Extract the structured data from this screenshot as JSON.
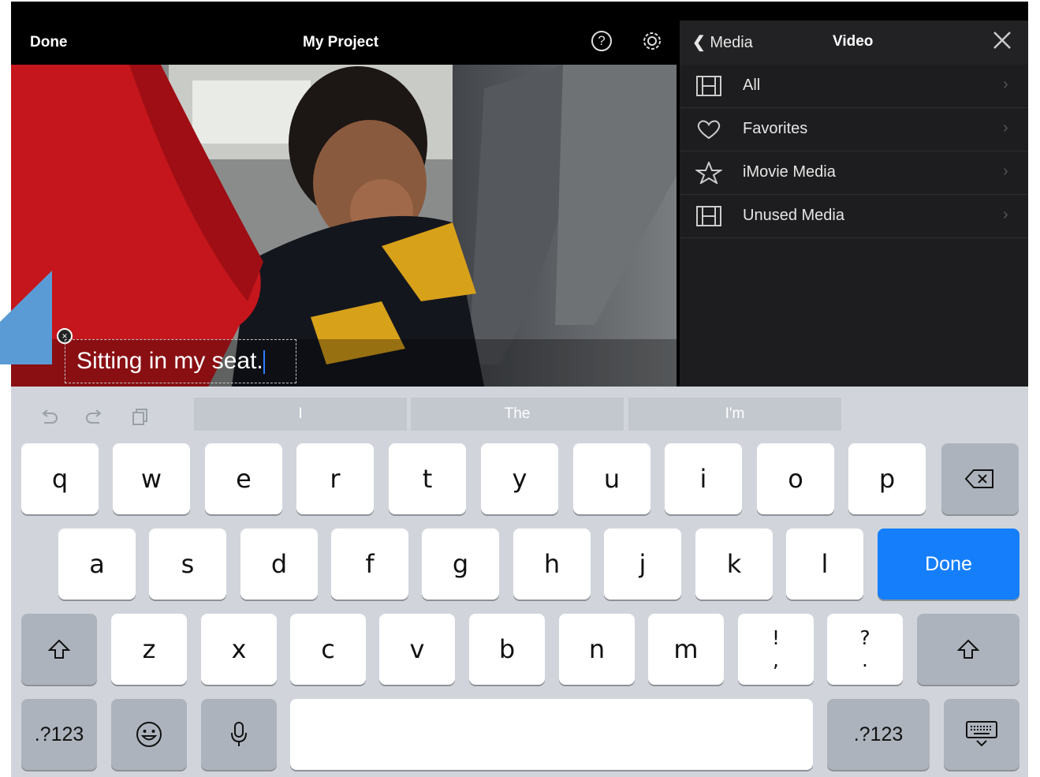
{
  "topbar": {
    "done_label": "Done",
    "project_title": "My Project",
    "help_icon": "?"
  },
  "media_panel": {
    "back_label": "Media",
    "title": "Video",
    "items": [
      {
        "label": "All",
        "icon": "film-icon"
      },
      {
        "label": "Favorites",
        "icon": "heart-icon"
      },
      {
        "label": "iMovie Media",
        "icon": "star-icon"
      },
      {
        "label": "Unused Media",
        "icon": "film-icon"
      }
    ]
  },
  "caption": {
    "text": "Sitting in my seat."
  },
  "keyboard": {
    "suggestions": [
      "I",
      "The",
      "I'm"
    ],
    "row1": [
      "q",
      "w",
      "e",
      "r",
      "t",
      "y",
      "u",
      "i",
      "o",
      "p"
    ],
    "row2": [
      "a",
      "s",
      "d",
      "f",
      "g",
      "h",
      "j",
      "k",
      "l"
    ],
    "row3": [
      "z",
      "x",
      "c",
      "v",
      "b",
      "n",
      "m"
    ],
    "punct1": {
      "top": "!",
      "bottom": ","
    },
    "punct2": {
      "top": "?",
      "bottom": "."
    },
    "done_label": "Done",
    "numbers_label": ".?123",
    "numbers_label_right": ".?123"
  },
  "colors": {
    "accent": "#147efb",
    "callout": "#5b9bd5",
    "panel_bg": "#1d1d1f"
  }
}
